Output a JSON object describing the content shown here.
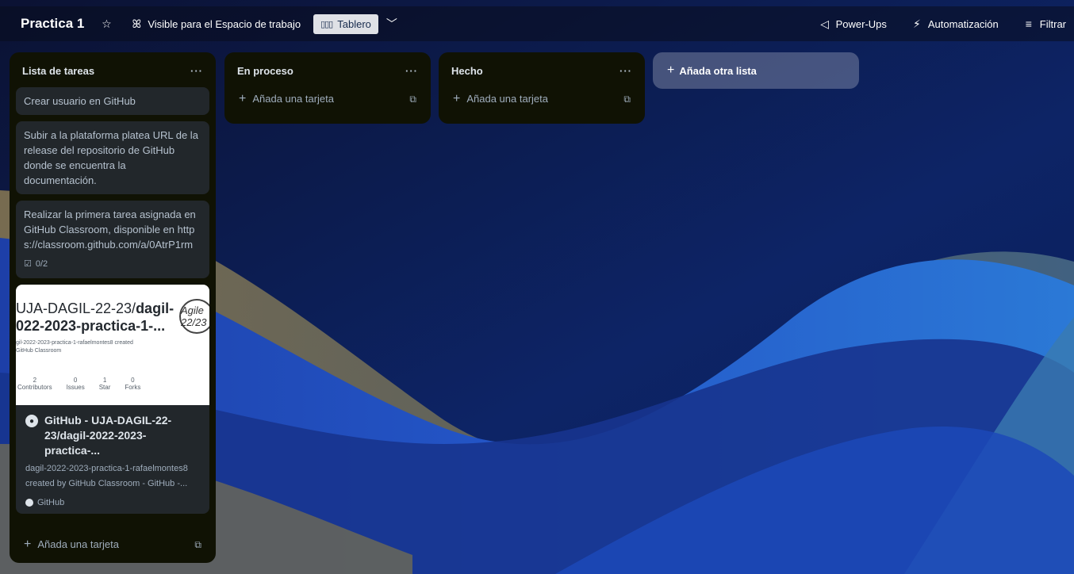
{
  "header": {
    "board_title": "Practica 1",
    "visibility_label": "Visible para el Espacio de trabajo",
    "view_label": "Tablero",
    "powerups_label": "Power-Ups",
    "automation_label": "Automatización",
    "filter_label": "Filtrar"
  },
  "lists": [
    {
      "title": "Lista de tareas",
      "cards": [
        {
          "text": "Crear usuario en GitHub"
        },
        {
          "text": "Subir a la plataforma platea URL de la release del repositorio de GitHub donde se encuentra la documentación."
        },
        {
          "text": "Realizar la primera tarea asignada en GitHub Classroom, disponible en https://classroom.github.com/a/0AtrP1rm",
          "checklist": "0/2"
        }
      ],
      "link_card": {
        "preview_line1_prefix": "UJA-DAGIL-22-23/",
        "preview_line1_bold": "dagil-",
        "preview_line2": "022-2023-practica-1-...",
        "preview_small": "gil-2022-2023-practica-1-rafaelmontes8 created",
        "preview_small2": "GitHub Classroom",
        "preview_logo": "Agile 22/23",
        "stats": [
          {
            "value": "2",
            "label": "Contributors"
          },
          {
            "value": "0",
            "label": "Issues"
          },
          {
            "value": "1",
            "label": "Star"
          },
          {
            "value": "0",
            "label": "Forks"
          }
        ],
        "title": "GitHub - UJA-DAGIL-22-23/dagil-2022-2023-practica-...",
        "description": "dagil-2022-2023-practica-1-rafaelmontes8 created by GitHub Classroom - GitHub -...",
        "source": "GitHub"
      },
      "add_card_label": "Añada una tarjeta"
    },
    {
      "title": "En proceso",
      "add_card_label": "Añada una tarjeta"
    },
    {
      "title": "Hecho",
      "add_card_label": "Añada una tarjeta"
    }
  ],
  "add_list_label": "Añada otra lista",
  "icons": {
    "star": "☆",
    "visibility": "ꕤ",
    "chevron": "﹀",
    "powerups": "◁",
    "bolt": "⚡",
    "filter": "≡",
    "more": "···",
    "plus": "+",
    "template": "⧉",
    "checklist": "☑",
    "github": "●"
  },
  "colors": {
    "list_bg": "#101204",
    "card_bg": "#22272b",
    "board_bg": "#0c1a4a"
  }
}
